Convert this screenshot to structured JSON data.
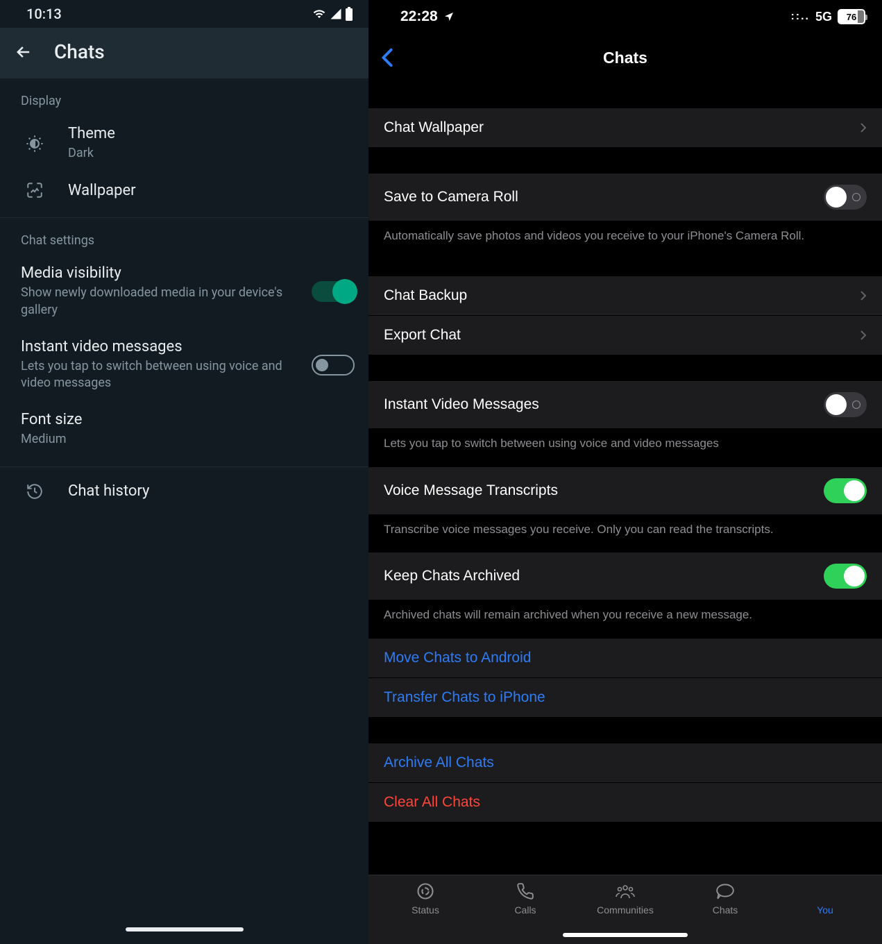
{
  "android": {
    "status": {
      "time": "10:13"
    },
    "appbar": {
      "title": "Chats"
    },
    "section_display": "Display",
    "theme": {
      "title": "Theme",
      "value": "Dark"
    },
    "wallpaper": {
      "title": "Wallpaper"
    },
    "section_chat_settings": "Chat settings",
    "media_visibility": {
      "title": "Media visibility",
      "sub": "Show newly downloaded media in your device's gallery",
      "on": true
    },
    "instant_video": {
      "title": "Instant video messages",
      "sub": "Lets you tap to switch between using voice and video messages",
      "on": false
    },
    "font_size": {
      "title": "Font size",
      "value": "Medium"
    },
    "chat_history": {
      "title": "Chat history"
    }
  },
  "ios": {
    "status": {
      "time": "22:28",
      "network": "5G",
      "battery": "76"
    },
    "nav": {
      "title": "Chats"
    },
    "chat_wallpaper": "Chat Wallpaper",
    "save_camera": {
      "title": "Save to Camera Roll",
      "on": false,
      "footer": "Automatically save photos and videos you receive to your iPhone's Camera Roll."
    },
    "chat_backup": "Chat Backup",
    "export_chat": "Export Chat",
    "instant_video": {
      "title": "Instant Video Messages",
      "on": false,
      "footer": "Lets you tap to switch between using voice and video messages"
    },
    "voice_transcripts": {
      "title": "Voice Message Transcripts",
      "on": true,
      "footer": "Transcribe voice messages you receive. Only you can read the transcripts."
    },
    "keep_archived": {
      "title": "Keep Chats Archived",
      "on": true,
      "footer": "Archived chats will remain archived when you receive a new message."
    },
    "move_android": "Move Chats to Android",
    "transfer_iphone": "Transfer Chats to iPhone",
    "archive_all": "Archive All Chats",
    "clear_all": "Clear All Chats",
    "tabs": {
      "status": "Status",
      "calls": "Calls",
      "communities": "Communities",
      "chats": "Chats",
      "you": "You"
    }
  }
}
